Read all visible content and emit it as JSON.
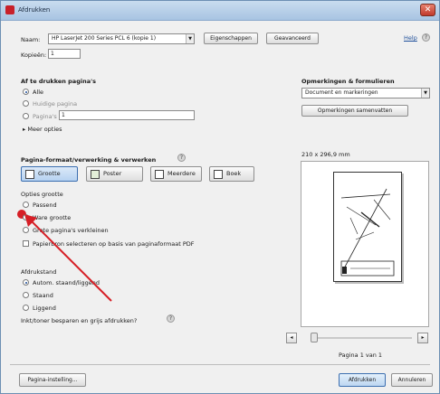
{
  "window": {
    "title": "Afdrukken",
    "close_glyph": "✕"
  },
  "printer": {
    "name_label": "Naam:",
    "name_value": "HP LaserJet 200 Series PCL 6 (kopie 1)",
    "properties_button": "Eigenschappen",
    "advanced_button": "Geavanceerd",
    "help_link": "Help",
    "copies_label": "Kopieën:",
    "copies_value": "1"
  },
  "pages_to_print": {
    "heading": "Af te drukken pagina's",
    "all": "Alle",
    "current_page": "Huidige pagina",
    "pages": "Pagina's",
    "pages_value": "1",
    "more_options": "Meer opties"
  },
  "comments_forms": {
    "heading": "Opmerkingen & formulieren",
    "select_value": "Document en markeringen",
    "summarize_button": "Opmerkingen samenvatten"
  },
  "preview": {
    "size_text": "210 x 296,9 mm",
    "page_counter": "Pagina 1 van 1"
  },
  "sizing": {
    "heading": "Pagina-formaat/verwerking & verwerken",
    "tabs": [
      "Grootte",
      "Poster",
      "Meerdere",
      "Boek"
    ],
    "options_heading": "Opties grootte",
    "fit": "Passend",
    "oversize": "Grote pagina's verkleinen",
    "custom_scale": "Ware grootte",
    "paper_source": "Papierbron selecteren op basis van paginaformaat PDF"
  },
  "orientation": {
    "heading": "Afdrukstand",
    "auto": "Autom. staand/liggend",
    "portrait": "Staand",
    "landscape": "Liggend",
    "hint": "Inkt/toner besparen en grijs afdrukken?"
  },
  "footer": {
    "page_setup": "Pagina-instelling...",
    "print": "Afdrukken",
    "cancel": "Annuleren"
  },
  "slider_minus": "◂",
  "slider_plus": "▸",
  "dropdown_arrow": "▼",
  "help_glyph": "?",
  "accent_color": "#d61f26"
}
